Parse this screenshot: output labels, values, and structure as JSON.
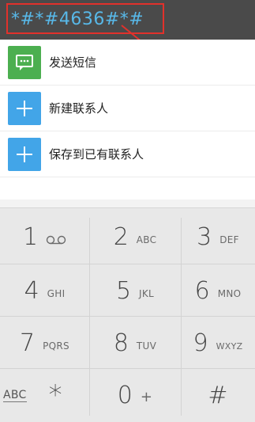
{
  "dialer": {
    "number": "*#*#4636#*#"
  },
  "actions": [
    {
      "label": "发送短信",
      "icon": "message-icon",
      "color": "#4caf50"
    },
    {
      "label": "新建联系人",
      "icon": "plus-icon",
      "color": "#42a5e8"
    },
    {
      "label": "保存到已有联系人",
      "icon": "plus-icon",
      "color": "#42a5e8"
    }
  ],
  "keys": [
    {
      "num": "1",
      "sub": "",
      "icon": "voicemail-icon"
    },
    {
      "num": "2",
      "sub": "ABC"
    },
    {
      "num": "3",
      "sub": "DEF"
    },
    {
      "num": "4",
      "sub": "GHI"
    },
    {
      "num": "5",
      "sub": "JKL"
    },
    {
      "num": "6",
      "sub": "MNO"
    },
    {
      "num": "7",
      "sub": "PQRS"
    },
    {
      "num": "8",
      "sub": "TUV"
    },
    {
      "num": "9",
      "sub": "WXYZ"
    },
    {
      "num": "*",
      "sub": "",
      "left_label": "ABC"
    },
    {
      "num": "0",
      "sub": "+"
    },
    {
      "num": "#",
      "sub": ""
    }
  ]
}
